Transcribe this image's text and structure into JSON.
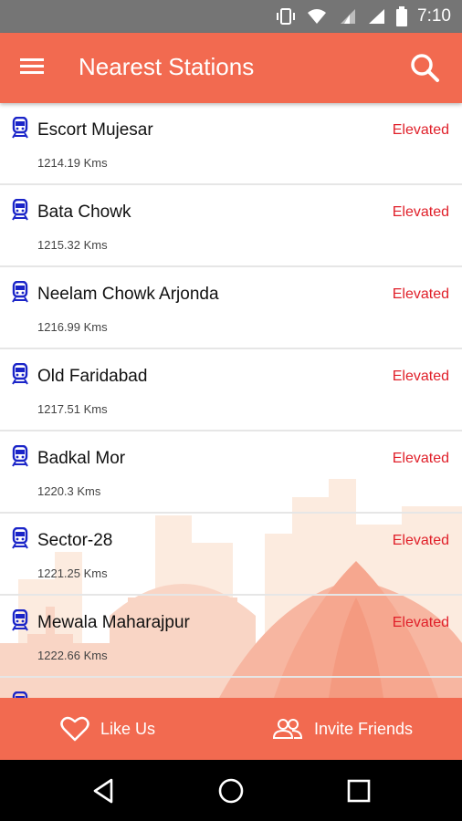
{
  "status_bar": {
    "time": "7:10",
    "icons": [
      "vibrate-icon",
      "wifi-icon",
      "lte-signal-icon",
      "signal-icon",
      "battery-icon"
    ]
  },
  "app_bar": {
    "title": "Nearest Stations",
    "menu_icon": "hamburger-menu-icon",
    "search_icon": "search-icon"
  },
  "stations": [
    {
      "name": "Escort Mujesar",
      "distance": "1214.19 Kms",
      "type": "Elevated"
    },
    {
      "name": "Bata Chowk",
      "distance": "1215.32 Kms",
      "type": "Elevated"
    },
    {
      "name": "Neelam Chowk Arjonda",
      "distance": "1216.99 Kms",
      "type": "Elevated"
    },
    {
      "name": "Old Faridabad",
      "distance": "1217.51 Kms",
      "type": "Elevated"
    },
    {
      "name": "Badkal Mor",
      "distance": "1220.3 Kms",
      "type": "Elevated"
    },
    {
      "name": "Sector-28",
      "distance": "1221.25 Kms",
      "type": "Elevated"
    },
    {
      "name": "Mewala Maharajpur",
      "distance": "1222.66 Kms",
      "type": "Elevated"
    }
  ],
  "bottom_bar": {
    "like_label": "Like Us",
    "invite_label": "Invite Friends"
  },
  "colors": {
    "primary": "#f26a50",
    "station_type": "#e0202a",
    "train_icon": "#1a24c8"
  }
}
